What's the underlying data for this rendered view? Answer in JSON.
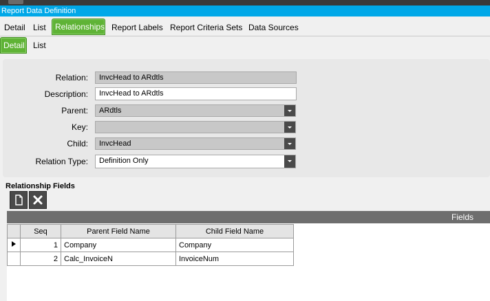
{
  "window": {
    "title": "Report Data Definition"
  },
  "main_tabs": [
    "Detail",
    "List",
    "Relationships",
    "Report Labels",
    "Report Criteria Sets",
    "Data Sources"
  ],
  "sub_tabs": [
    "Detail",
    "List"
  ],
  "form": {
    "relation_label": "Relation:",
    "relation_value": "InvcHead to ARdtls",
    "description_label": "Description:",
    "description_value": "InvcHead to ARdtls",
    "parent_label": "Parent:",
    "parent_value": "ARdtls",
    "key_label": "Key:",
    "key_value": "",
    "child_label": "Child:",
    "child_value": "InvcHead",
    "relation_type_label": "Relation Type:",
    "relation_type_value": "Definition Only"
  },
  "relationship_fields": {
    "title": "Relationship Fields",
    "grid_header": "Fields",
    "columns": [
      "Seq",
      "Parent Field Name",
      "Child Field Name"
    ],
    "rows": [
      {
        "seq": "1",
        "parent": "Company",
        "child": "Company"
      },
      {
        "seq": "2",
        "parent": "Calc_InvoiceN",
        "child": "InvoiceNum"
      }
    ]
  },
  "icons": {
    "new": "new-document-icon",
    "delete": "delete-x-icon",
    "row_pointer": "row-pointer-icon",
    "dropdown": "chevron-down-icon"
  },
  "colors": {
    "title_bar": "#00a8e8",
    "active_tab": "#5fb336",
    "grid_header": "#6e6e6e"
  }
}
